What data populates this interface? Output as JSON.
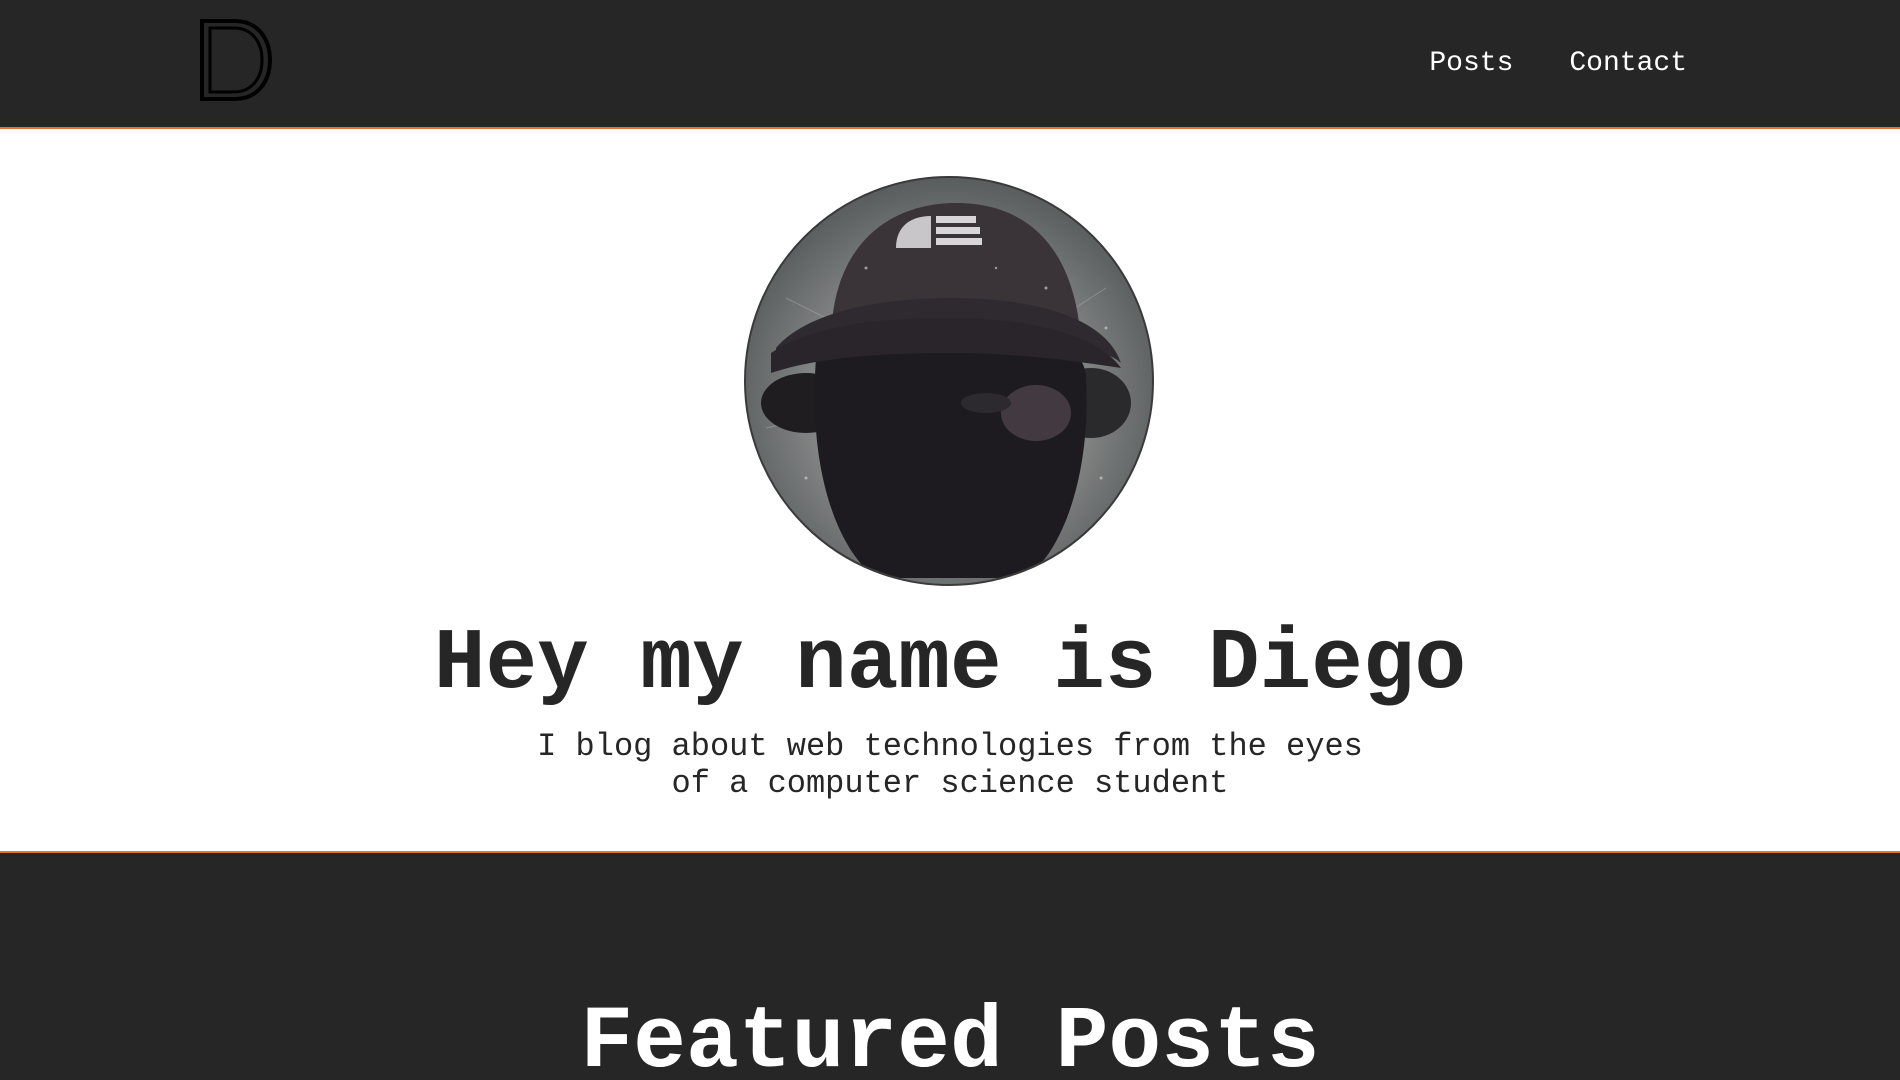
{
  "nav": {
    "logo_letter": "D",
    "links": [
      {
        "label": "Posts"
      },
      {
        "label": "Contact"
      }
    ]
  },
  "hero": {
    "avatar_icon": "profile-photo",
    "title": "Hey my name is Diego",
    "subtitle_line1": "I blog about web technologies from the eyes",
    "subtitle_line2": "of a computer science student"
  },
  "featured": {
    "title": "Featured Posts"
  },
  "colors": {
    "dark": "#262626",
    "accent": "#e2752b",
    "light": "#ffffff"
  }
}
